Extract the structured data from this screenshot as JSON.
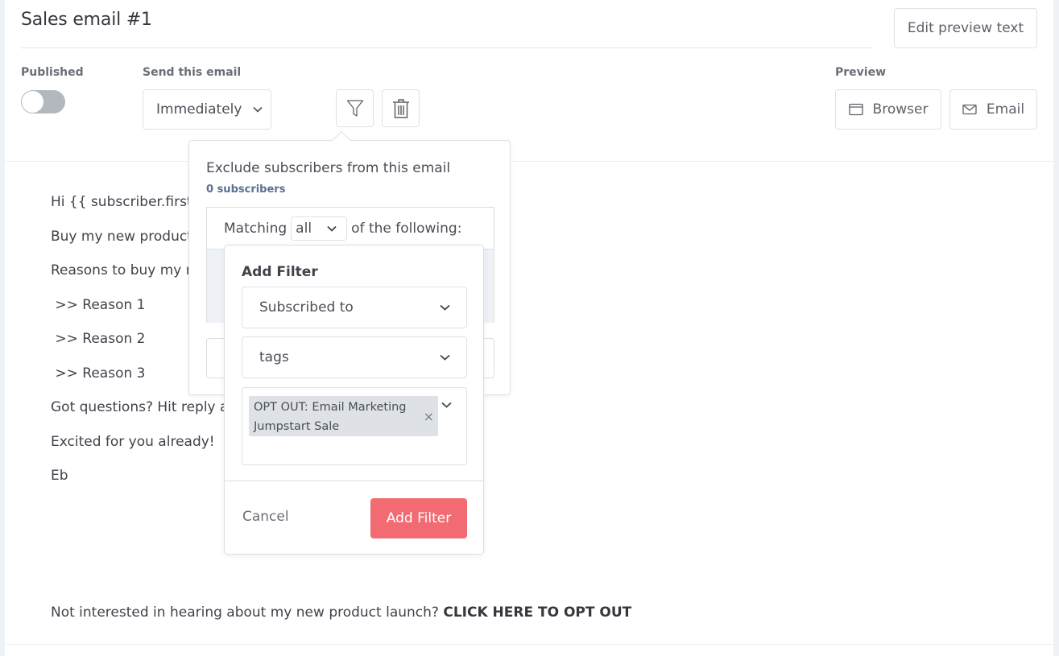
{
  "header": {
    "title": "Sales email #1",
    "edit_preview_label": "Edit preview text"
  },
  "controls": {
    "published_label": "Published",
    "published_on": false,
    "send_label": "Send this email",
    "send_value": "Immediately",
    "filter_icon": "filter-icon",
    "trash_icon": "trash-icon",
    "preview_label": "Preview",
    "browser_label": "Browser",
    "email_label": "Email"
  },
  "email_body": {
    "lines": [
      "Hi {{ subscriber.first_n",
      "Buy my new product i",
      "Reasons to buy my ne",
      " >> Reason 1",
      " >> Reason 2",
      " >> Reason 3",
      "Got questions? Hit reply ar",
      "Excited for you already!",
      "Eb"
    ],
    "optout_prefix": "Not interested in hearing about my new product launch? ",
    "optout_link": "CLICK HERE TO OPT OUT"
  },
  "exclude_popover": {
    "title": "Exclude subscribers from this email",
    "count": "0 subscribers",
    "matching_prefix": "Matching",
    "matching_value": "all",
    "matching_suffix": "of the following:"
  },
  "add_filter": {
    "title": "Add Filter",
    "field_1": "Subscribed to",
    "field_2": "tags",
    "selected_tag": "OPT OUT: Email Marketing Jumpstart Sale",
    "cancel_label": "Cancel",
    "submit_label": "Add Filter",
    "submit_color": "#f26b73"
  }
}
